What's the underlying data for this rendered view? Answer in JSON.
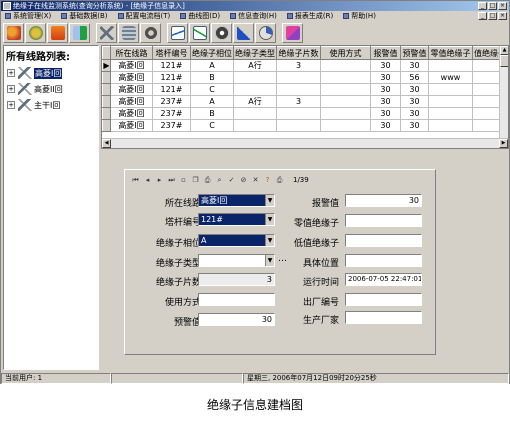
{
  "window": {
    "title": "绝缘子在线监测系统(查询分析系统) - [绝缘子信息录入]",
    "menu": [
      "系统管理(X)",
      "基础数据(B)",
      "配置电流档(T)",
      "曲线图(D)",
      "信息查询(H)",
      "报表生成(R)",
      "帮助(H)"
    ]
  },
  "toolbar": {
    "icons": [
      "users-icon",
      "globe-icon",
      "book-icon",
      "exit-icon",
      "tower-icon",
      "insulator-icon",
      "gear-icon",
      "chart-icon",
      "curve-icon",
      "disk-icon",
      "triangle-icon",
      "pie-icon",
      "report-icon"
    ]
  },
  "tree": {
    "heading": "所有线路列表:",
    "items": [
      {
        "label": "高菱I回",
        "selected": true
      },
      {
        "label": "高菱II回",
        "selected": false
      },
      {
        "label": "主干I回",
        "selected": false
      }
    ]
  },
  "grid": {
    "columns": [
      "所在线路",
      "塔杆编号",
      "绝缘子相位",
      "绝缘子类型",
      "绝缘子片数",
      "使用方式",
      "报警值",
      "预警值",
      "零值绝缘子",
      "值绝缘子"
    ],
    "rows": [
      [
        "高菱I回",
        "121#",
        "A",
        "A行",
        "3",
        "",
        "30",
        "30",
        "",
        ""
      ],
      [
        "高菱I回",
        "121#",
        "B",
        "",
        "",
        "",
        "30",
        "56",
        "www",
        ""
      ],
      [
        "高菱I回",
        "121#",
        "C",
        "",
        "",
        "",
        "30",
        "30",
        "",
        ""
      ],
      [
        "高菱I回",
        "237#",
        "A",
        "A行",
        "3",
        "",
        "30",
        "30",
        "",
        ""
      ],
      [
        "高菱I回",
        "237#",
        "B",
        "",
        "",
        "",
        "30",
        "30",
        "",
        ""
      ],
      [
        "高菱I回",
        "237#",
        "C",
        "",
        "",
        "",
        "30",
        "30",
        "",
        ""
      ]
    ]
  },
  "form": {
    "record_counter": "1/39",
    "fields": {
      "line": {
        "label": "所在线路",
        "value": "高菱I回"
      },
      "tower": {
        "label": "塔杆编号",
        "value": "121#"
      },
      "phase": {
        "label": "绝缘子相位",
        "value": "A"
      },
      "type": {
        "label": "绝缘子类型",
        "value": ""
      },
      "count": {
        "label": "绝缘子片数",
        "value": "3"
      },
      "usage": {
        "label": "使用方式",
        "value": ""
      },
      "prewarn": {
        "label": "预警值",
        "value": "30"
      },
      "alarm": {
        "label": "报警值",
        "value": "30"
      },
      "zero": {
        "label": "零值绝缘子",
        "value": ""
      },
      "low": {
        "label": "低值绝缘子",
        "value": ""
      },
      "location": {
        "label": "具体位置",
        "value": ""
      },
      "runtime": {
        "label": "运行时间",
        "value": "2006-07-05 22:47:01"
      },
      "factory_no": {
        "label": "出厂编号",
        "value": ""
      },
      "maker": {
        "label": "生产厂家",
        "value": ""
      }
    }
  },
  "status": {
    "user": "当前用户: 1",
    "datetime": "星期三, 2006年07月12日09时20分25秒"
  },
  "caption": "绝缘子信息建档图",
  "colors": {
    "window_bg": "#d4d0c8",
    "title_blue": "#0a246a",
    "selection": "#0a246a"
  }
}
